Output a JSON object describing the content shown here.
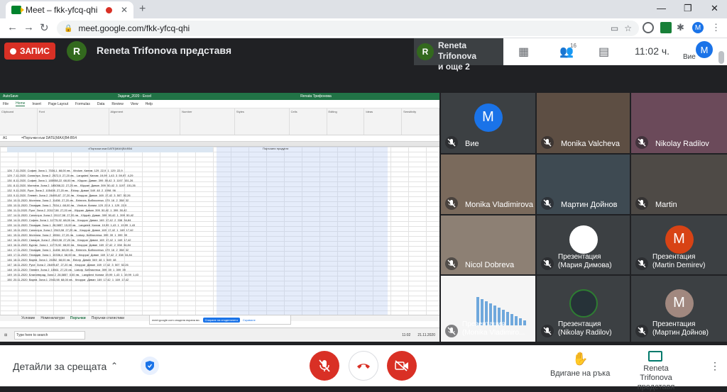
{
  "browser": {
    "tab_title": "Meet – fkk-yfcq-qhi",
    "url": "meet.google.com/fkk-yfcq-qhi",
    "profile_initial": "M"
  },
  "meet_top": {
    "record_label": "ЗАПИС",
    "presenter_initial": "R",
    "presenter_text": "Reneta Trifonova представя",
    "present_chip_line1": "Reneta Trifonova",
    "present_chip_line2": "и още 2",
    "participants_count": "16",
    "clock": "11:02 ч.",
    "self_label": "Вие",
    "self_initial": "M"
  },
  "excel": {
    "title_center": "Задачи_2020 - Excel",
    "title_user": "Renata Трифонова",
    "menu": [
      "File",
      "Home",
      "Insert",
      "Page Layout",
      "Formulas",
      "Data",
      "Review",
      "View",
      "Help"
    ],
    "menu_active": "Home",
    "ribbon_groups": [
      "Clipboard",
      "Font",
      "Alignment",
      "Number",
      "Styles",
      "Cells",
      "Editing",
      "Ideas",
      "Sensitivity"
    ],
    "name_box": "A1",
    "formula": "=Поръчки към DATE(MAX(B4:B54",
    "table_title": "=Поръчки към DATE(MAX(B4:B54",
    "right_table_title": "Поръчани продукти",
    "rows": [
      "126  7.11.2020  София  Зона 1  7534,1  68,00 лв.   Vindum  Килим  129  22,9  1  129  22,9",
      "129  7.11.2020  Силистра  Зона 2  2572,5  27,20 лв.   Langsted  Килим  19,99  1,43  3  59,97  4,29",
      "130  8.11.2020  София  Зона 1  185058,22  68,00 лв.   Klippan  Диван  399  50,42  3  1197  151,26",
      "131  8.11.2020  Монтана  Зона 2  185058,22  27,20 лв.   Klippan  Диван  399  50,42  3  1197  151,26",
      "132  9.11.2020  Русе  Зона 2  105408  27,20 лв.   Ektorp  Диван  549  48  2  1098  96",
      "133  9.11.2020  Плевен  Зона 2  26495,87  27,20 лв.   Кнорраг  Диван  169  17,42  3  507  52,26",
      "134  10.11.2020  Монтана  Зона 2  11456  27,20 лв.   Brimnes  Библиотека  179  16  2  358  32",
      "135  10.11.2020  Пловдив  Зона 1  7534,1  68,00 лв.   Vindum  Килим  129  22,9  1  129  22,9",
      "136  11.11.2020  Русе  Зона 2  20117,58  27,20 лв.   Klippan  Диван  399  50,42  1  399  50,42",
      "137  14.11.2020  Силистра  Зона 2  20117,58  27,20 лв.   Klippan  Диван  399  50,42  1  399  50,42",
      "138  14.11.2020  София  Зона 1  11775,92  68,00 лв.   Кнорраг  Диван  169  17,42  2  338  34,84",
      "139  14.11.2020  Пловдив  Зона 1  28,5857  15,00 лв.   Langsted  Килим  19,99  1,43  1  19,99  1,43",
      "140  15.11.2020  Силистра  Зона 2  2943,98  27,20 лв.   Кнорраг  Диван  169  17,42  1  169  17,42",
      "141  15.11.2020  Монтана  Зона 2  15561  27,20 лв.   Liatorp  Библиотека  399  39  1  399  39",
      "142  16.11.2020  Свищов  Зона 2  2943,98  27,20 лв.   Кнорраг  Диван  169  17,42  1  169  17,42",
      "143  16.11.2020  Бургас  Зона 1  11775,92  68,00 лв.   Кнорраг  Диван  169  17,42  2  338  34,84",
      "144  17.11.2020  Пловдив  Зона 1  11456  68,00 лв.   Brimnes  Библиотека  179  16  2  358  32",
      "145  17.11.2020  Пловдив  Зона 1  10336,4  68,00 лв.   Кнорраг  Диван  169  17,42  2  338  34,84",
      "146  18.11.2020  Варна  Зона 1  26352  68,00 лв.   Ektorp  Диван  549  48  1  549  48",
      "147  18.11.2020  Русе  Зона 2  26495,87  27,20 лв.   Кнорраг  Диван  169  17,42  3  507  52,26",
      "148  19.11.2020  Плевен  Зона 2  15561  27,20 лв.   Liatorp  Библиотека  399  39  1  399  39",
      "149  19.11.2020  Благоевград  Зона 2  28,5857  0,00 лв.   Langsted  Килим  19,99  1,43  1  19,99  1,43",
      "150  20.11.2020  Варна  Зона 1  2943,98  68,00 лв.   Кнорраг  Диван  169  17,42  1  169  17,42"
    ],
    "sheet_tabs": [
      "Условие",
      "Номенклатури",
      "Поръчки",
      "Поръчки статистики"
    ],
    "sheet_active": "Поръчки",
    "share_text": "meet.google.com споделя екрана ви.",
    "share_stop": "Спиране на споделянето",
    "share_hide": "Скриване",
    "taskbar_search": "Type here to search",
    "taskbar_time": "11:02",
    "taskbar_date": "21.11.2020"
  },
  "tiles": [
    {
      "name": "Вие",
      "initial": "M",
      "color": "#1a73e8"
    },
    {
      "name": "Monika Valcheva"
    },
    {
      "name": "Nikolay Radilov"
    },
    {
      "name": "Monika Vladimirova"
    },
    {
      "name": "Мартин Дойнов"
    },
    {
      "name": "Martin"
    },
    {
      "name": "Nicol Dobreva"
    },
    {
      "name": "Презентация",
      "sub": "(Мария Димова)"
    },
    {
      "name": "Презентация",
      "sub": "(Martin Demirev)",
      "initial": "M",
      "color": "#d84315"
    },
    {
      "name": "Презентация",
      "sub": "(Monika Vladimiro..."
    },
    {
      "name": "Презентация",
      "sub": "(Nikolay Radilov)"
    },
    {
      "name": "Презентация",
      "sub": "(Мартин Дойнов)",
      "initial": "M",
      "color": "#a1887f"
    }
  ],
  "bottom": {
    "details_label": "Детайли за срещата",
    "raise_label": "Вдигане на ръка",
    "present_line1": "Reneta Trifonova",
    "present_line2": "представя"
  }
}
